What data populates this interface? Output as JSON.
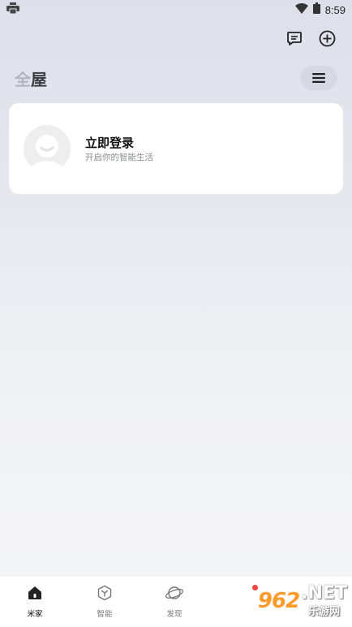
{
  "status_bar": {
    "time": "8:59",
    "icons": [
      "printer-icon",
      "wifi-icon",
      "battery-icon"
    ]
  },
  "header": {
    "title_faded": "全",
    "title_solid": "屋",
    "actions": [
      "message-icon",
      "add-circle-icon"
    ],
    "menu_icon": "menu-icon"
  },
  "login_card": {
    "title": "立即登录",
    "subtitle": "开启你的智能生活"
  },
  "bottom_nav": {
    "items": [
      {
        "label": "米家",
        "icon": "home-icon",
        "active": true
      },
      {
        "label": "智能",
        "icon": "cube-icon",
        "active": false
      },
      {
        "label": "发现",
        "icon": "planet-icon",
        "active": false
      }
    ],
    "badge_color": "#f2453d"
  },
  "watermark": {
    "number": "962",
    "suffix": ".NET",
    "text": "乐游网"
  }
}
